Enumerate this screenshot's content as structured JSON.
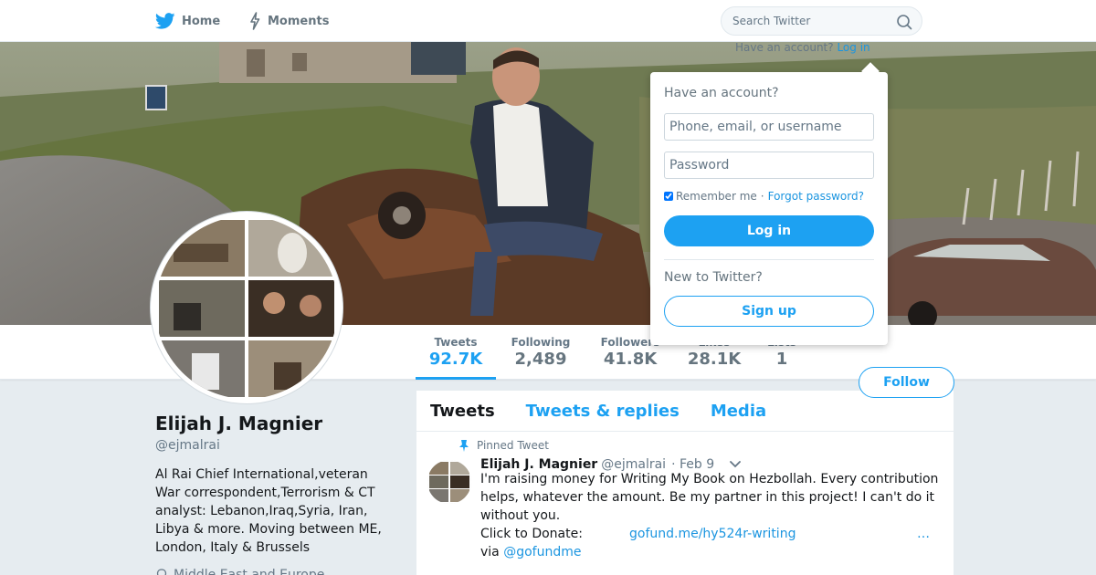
{
  "nav": {
    "home_label": "Home",
    "moments_label": "Moments",
    "home_icon": "twitter-bird-icon",
    "moments_icon": "lightning-icon"
  },
  "search": {
    "placeholder": "Search Twitter",
    "icon": "search-icon"
  },
  "banner": {
    "behind_text": "Have an account?",
    "behind_link": "Log in"
  },
  "stats": [
    {
      "label": "Tweets",
      "value": "92.7K"
    },
    {
      "label": "Following",
      "value": "2,489"
    },
    {
      "label": "Followers",
      "value": "41.8K"
    },
    {
      "label": "Likes",
      "value": "28.1K"
    },
    {
      "label": "Lists",
      "value": "1"
    }
  ],
  "profile": {
    "name": "Elijah J. Magnier",
    "handle": "@ejmalrai",
    "bio": "Al Rai Chief International,veteran War correspondent,Terrorism & CT analyst: Lebanon,Iraq,Syria, Iran, Libya & more. Moving between ME, London, Italy & Brussels",
    "location": "Middle East and Europe",
    "follow_label": "Follow"
  },
  "timeline": {
    "tabs": [
      "Tweets",
      "Tweets & replies",
      "Media"
    ],
    "pinned_label": "Pinned Tweet",
    "tweet": {
      "name": "Elijah J. Magnier",
      "handle": "@ejmalrai",
      "date": "· Feb 9",
      "body": "I'm raising money for Writing My Book on Hezbollah. Every contribution helps, whatever the amount. Be my partner in this project! I can't do it without you.",
      "donate_label": "Click to Donate:",
      "donate_link": "gofund.me/hy524r-writing",
      "via_label": "via",
      "via_link": "@gofundme",
      "more": "…"
    }
  },
  "login": {
    "title": "Have an account?",
    "username_placeholder": "Phone, email, or username",
    "password_placeholder": "Password",
    "remember_label": "Remember me",
    "separator": "·",
    "forgot_label": "Forgot password?",
    "login_label": "Log in",
    "new_label": "New to Twitter?",
    "signup_label": "Sign up"
  },
  "colors": {
    "accent": "#1da1f2",
    "link": "#1b95e0",
    "background": "#e6ecf0"
  }
}
